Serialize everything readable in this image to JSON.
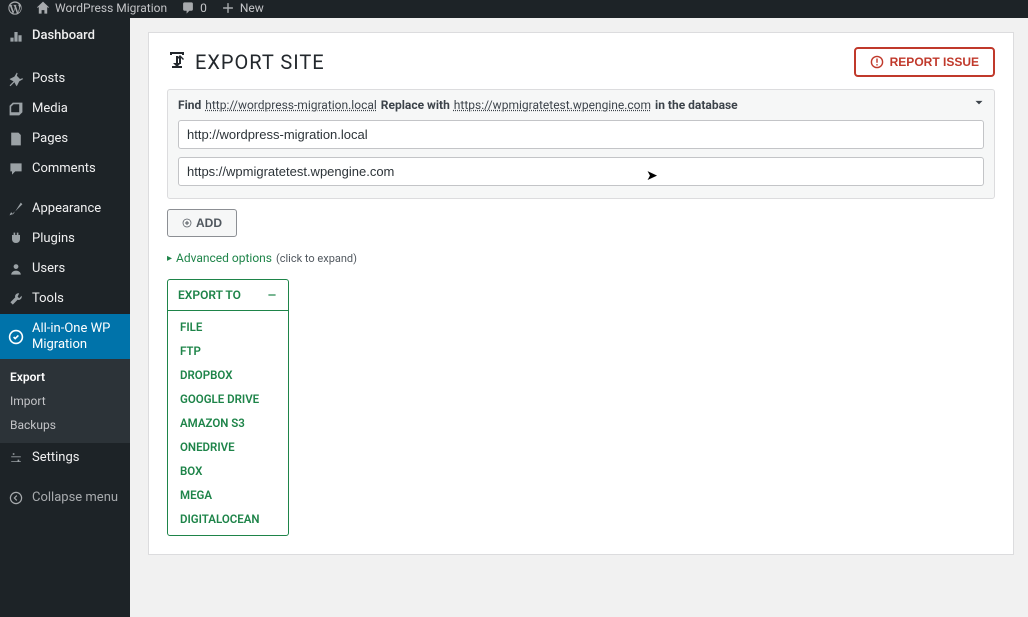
{
  "adminbar": {
    "site_name": "WordPress Migration",
    "comments_count": "0",
    "new_label": "New"
  },
  "sidebar": {
    "items": [
      {
        "id": "dashboard",
        "label": "Dashboard"
      },
      {
        "id": "posts",
        "label": "Posts"
      },
      {
        "id": "media",
        "label": "Media"
      },
      {
        "id": "pages",
        "label": "Pages"
      },
      {
        "id": "comments",
        "label": "Comments"
      },
      {
        "id": "appearance",
        "label": "Appearance"
      },
      {
        "id": "plugins",
        "label": "Plugins"
      },
      {
        "id": "users",
        "label": "Users"
      },
      {
        "id": "tools",
        "label": "Tools"
      },
      {
        "id": "ai1wm",
        "label": "All-in-One WP Migration"
      },
      {
        "id": "settings",
        "label": "Settings"
      }
    ],
    "submenu": [
      {
        "id": "export",
        "label": "Export",
        "active": true
      },
      {
        "id": "import",
        "label": "Import",
        "active": false
      },
      {
        "id": "backups",
        "label": "Backups",
        "active": false
      }
    ],
    "collapse_label": "Collapse menu"
  },
  "header": {
    "title": "EXPORT SITE",
    "report_label": "REPORT ISSUE"
  },
  "find_replace": {
    "label_find": "Find",
    "find_url": "http://wordpress-migration.local",
    "label_replace": "Replace with",
    "replace_url": "https://wpmigratetest.wpengine.com",
    "label_suffix": "in the database",
    "input_find_value": "http://wordpress-migration.local",
    "input_replace_value": "https://wpmigratetest.wpengine.com",
    "add_label": "ADD"
  },
  "advanced": {
    "link_label": "Advanced options",
    "hint": "(click to expand)"
  },
  "export_dropdown": {
    "head_label": "EXPORT TO",
    "options": [
      "FILE",
      "FTP",
      "DROPBOX",
      "GOOGLE DRIVE",
      "AMAZON S3",
      "ONEDRIVE",
      "BOX",
      "MEGA",
      "DIGITALOCEAN"
    ]
  }
}
